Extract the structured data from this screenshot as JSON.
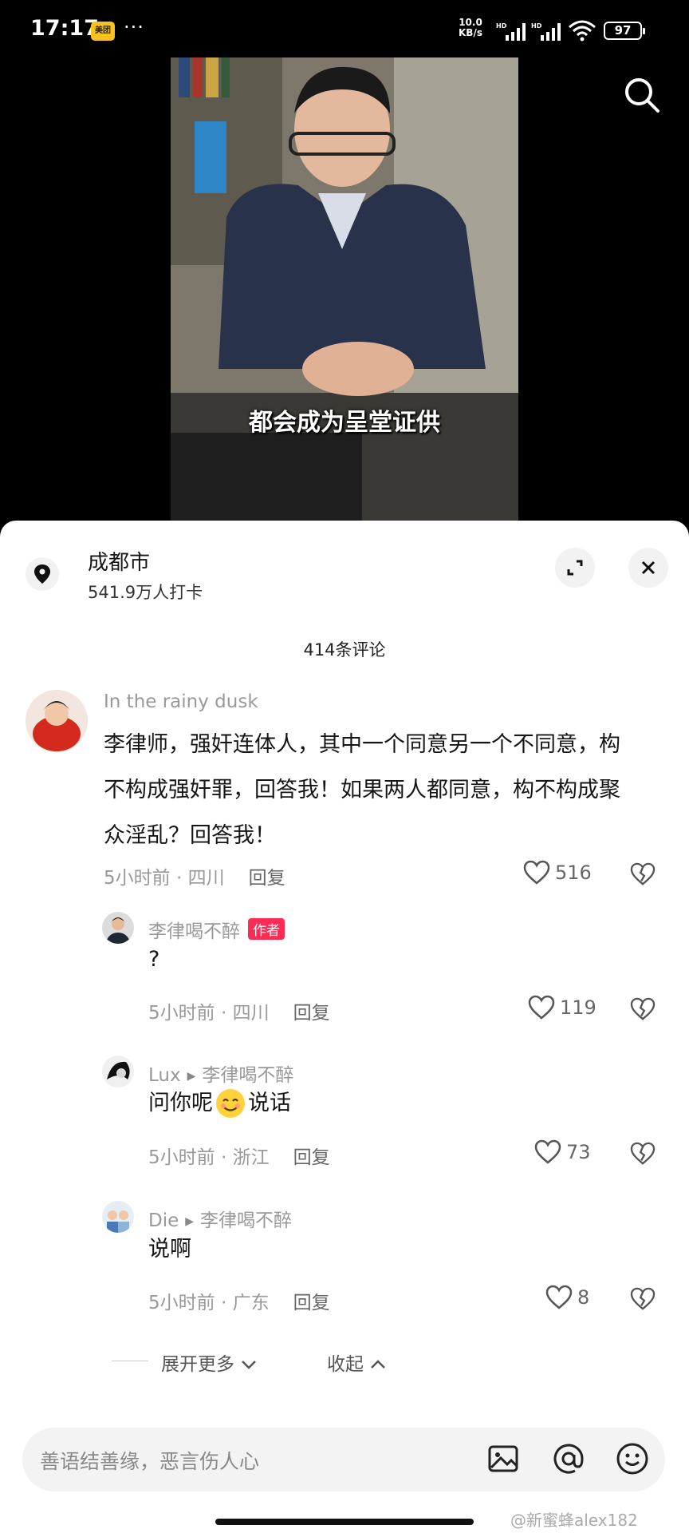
{
  "status_bar": {
    "time": "17:17",
    "app_badge": "美团",
    "more": "···",
    "net_speed_value": "10.0",
    "net_speed_unit": "KB/s",
    "battery": "97"
  },
  "video": {
    "subtitle": "都会成为呈堂证供"
  },
  "location": {
    "title": "成都市",
    "subtitle": "541.9万人打卡"
  },
  "comment_count": "414条评论",
  "comments": [
    {
      "user": "In the rainy dusk",
      "text": "李律师，强奸连体人，其中一个同意另一个不同意，构不构成强奸罪，回答我！如果两人都同意，构不构成聚众淫乱？回答我！",
      "time": "5小时前 · 四川",
      "reply": "回复",
      "likes": "516"
    },
    {
      "user": "李律喝不醉",
      "tag": "作者",
      "text": "?",
      "time": "5小时前 · 四川",
      "reply": "回复",
      "likes": "119"
    },
    {
      "user": "Lux",
      "reply_to": "李律喝不醉",
      "text_a": "问你呢",
      "text_b": "说话",
      "time": "5小时前 · 浙江",
      "reply": "回复",
      "likes": "73"
    },
    {
      "user": "Die",
      "reply_to": "李律喝不醉",
      "text": "说啊",
      "time": "5小时前 · 广东",
      "reply": "回复",
      "likes": "8"
    }
  ],
  "expand_more": "展开更多",
  "collapse": "收起",
  "input_placeholder": "善语结善缘，恶言伤人心",
  "watermark": "@新蜜蜂alex182",
  "colors": {
    "author_tag": "#fe2c55",
    "meta": "#999999"
  }
}
